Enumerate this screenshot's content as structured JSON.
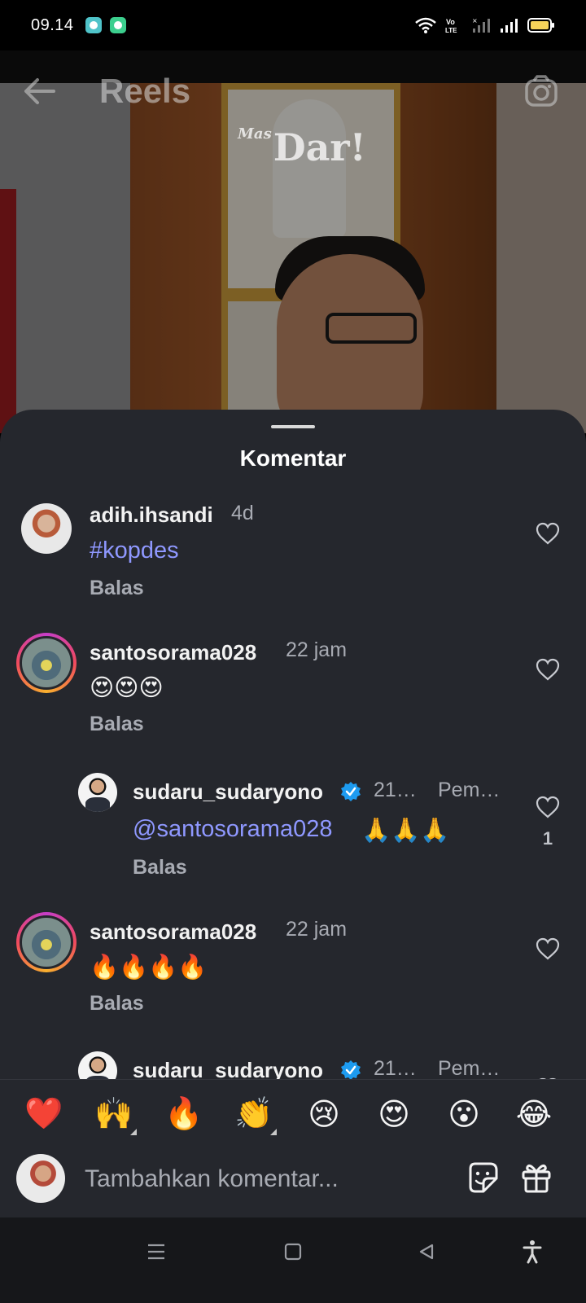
{
  "status_bar": {
    "time": "09.14",
    "icons": [
      "chat-app-icon",
      "shield-app-icon",
      "wifi-icon",
      "volte-icon",
      "signal-1-icon",
      "signal-2-icon",
      "battery-icon"
    ],
    "volte_label": "Vo LTE"
  },
  "header": {
    "title": "Reels",
    "back_icon": "arrow-left-icon",
    "camera_icon": "camera-icon"
  },
  "video": {
    "watermark_prefix": "Mas",
    "watermark": "Dar!"
  },
  "sheet": {
    "title": "Komentar"
  },
  "comments": [
    {
      "username": "adih.ihsandi",
      "time": "4d",
      "text": "#kopdes",
      "reply_label": "Balas"
    },
    {
      "username": "santosorama028",
      "time": "22 jam",
      "text": "😍😍😍",
      "reply_label": "Balas"
    },
    {
      "username": "sudaru_sudaryono",
      "time": "21…",
      "pinned": "Pem…",
      "mention": "@santosorama028",
      "text": "🙏🙏🙏",
      "reply_label": "Balas",
      "likes": "1"
    },
    {
      "username": "santosorama028",
      "time": "22 jam",
      "text": "🔥🔥🔥🔥",
      "reply_label": "Balas"
    },
    {
      "username": "sudaru_sudaryono",
      "time": "21…",
      "pinned": "Pem…"
    }
  ],
  "reactions": [
    "❤️",
    "🙌",
    "🔥",
    "👏",
    "😢",
    "😍",
    "😮",
    "😂"
  ],
  "input": {
    "placeholder": "Tambahkan komentar..."
  },
  "colors": {
    "sheet_bg": "#25272d",
    "link": "#8f98ff",
    "muted": "#a8abb3",
    "verified": "#1d9bf0"
  }
}
